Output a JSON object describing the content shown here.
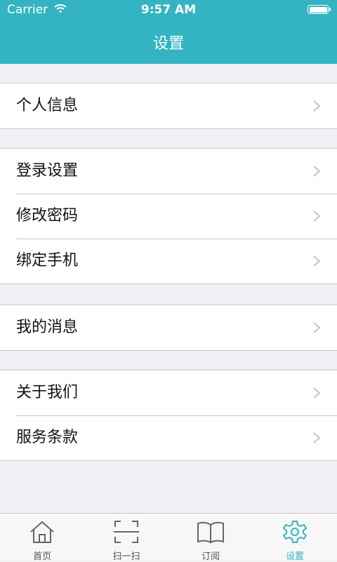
{
  "status_bar": {
    "carrier": "Carrier",
    "time": "9:57 AM"
  },
  "nav": {
    "title": "设置"
  },
  "groups": [
    {
      "items": [
        {
          "label": "个人信息"
        }
      ]
    },
    {
      "items": [
        {
          "label": "登录设置"
        },
        {
          "label": "修改密码"
        },
        {
          "label": "绑定手机"
        }
      ]
    },
    {
      "items": [
        {
          "label": "我的消息"
        }
      ]
    },
    {
      "items": [
        {
          "label": "关于我们"
        },
        {
          "label": "服务条款"
        }
      ]
    }
  ],
  "tabbar": {
    "items": [
      {
        "label": "首页",
        "icon": "home-icon"
      },
      {
        "label": "扫一扫",
        "icon": "scan-icon"
      },
      {
        "label": "订阅",
        "icon": "book-icon"
      },
      {
        "label": "设置",
        "icon": "gear-icon",
        "active": true
      }
    ]
  },
  "colors": {
    "accent": "#34b3c2",
    "background": "#eff0f4",
    "separator": "#c8c8cc"
  }
}
